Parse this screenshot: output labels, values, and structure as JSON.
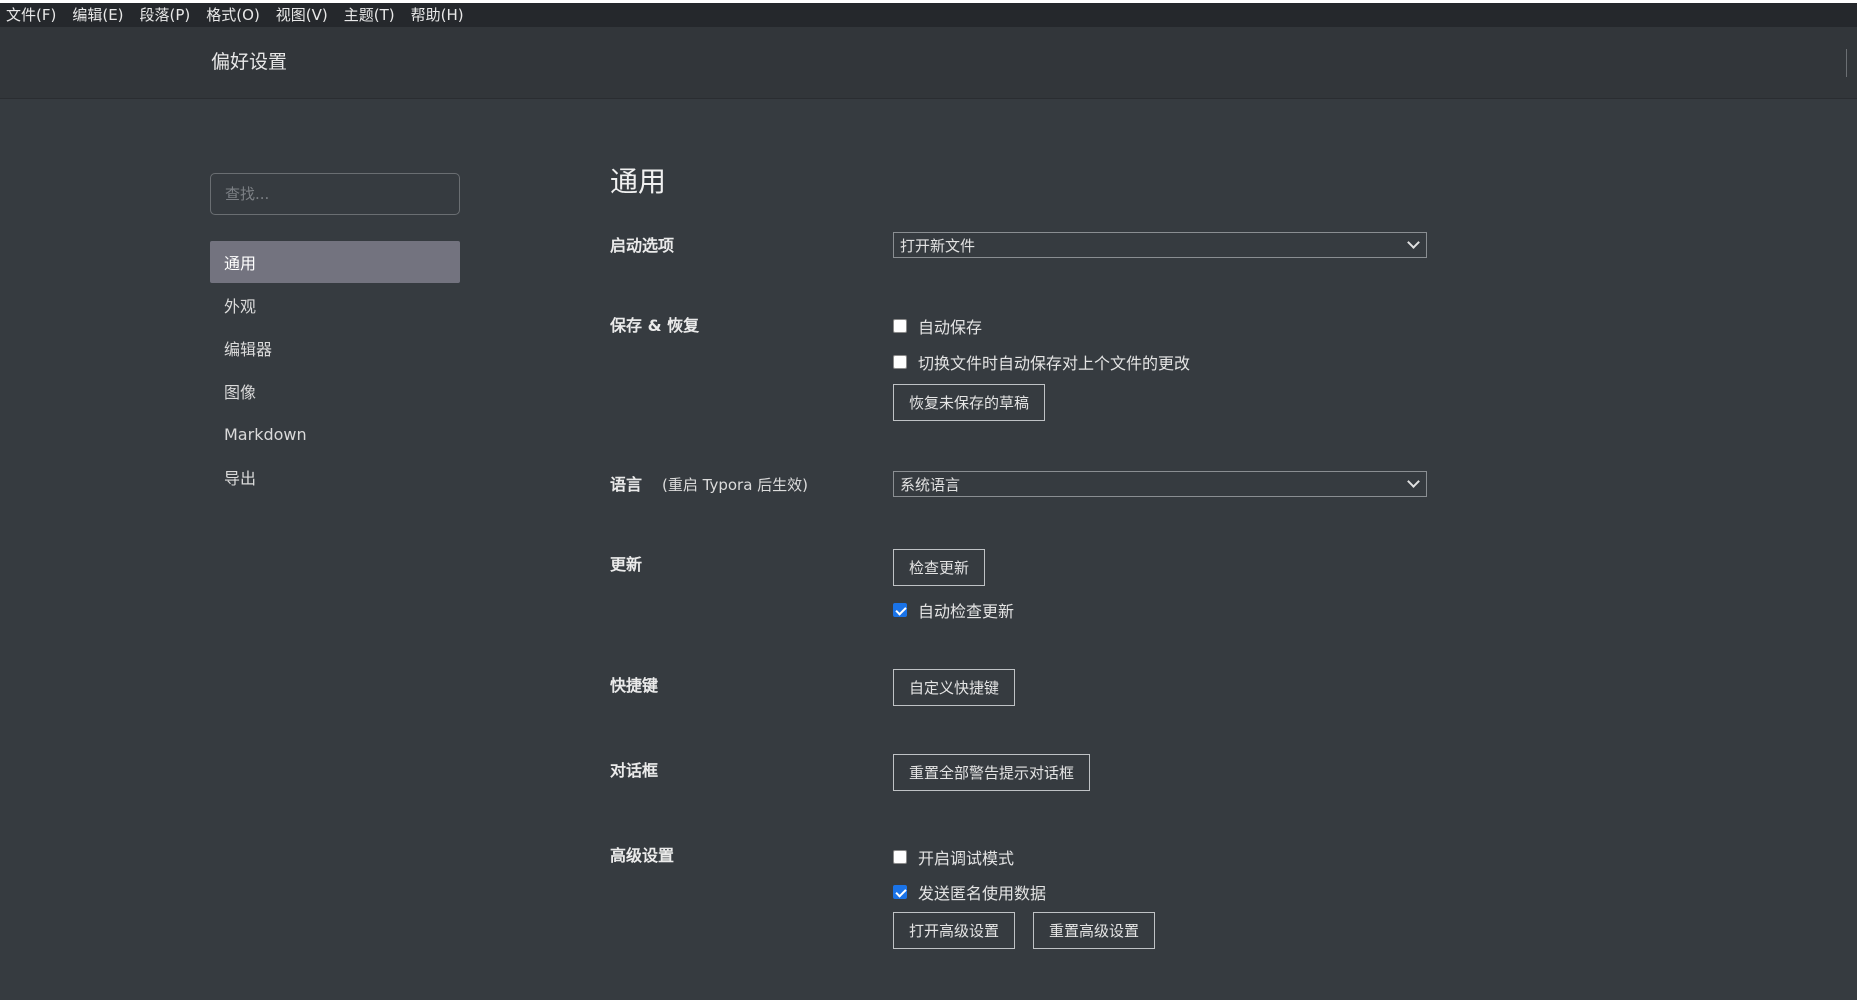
{
  "menubar": {
    "items": [
      "文件(F)",
      "编辑(E)",
      "段落(P)",
      "格式(O)",
      "视图(V)",
      "主题(T)",
      "帮助(H)"
    ]
  },
  "window": {
    "title": "偏好设置"
  },
  "sidebar": {
    "search_placeholder": "查找...",
    "items": [
      {
        "label": "通用",
        "active": true
      },
      {
        "label": "外观",
        "active": false
      },
      {
        "label": "编辑器",
        "active": false
      },
      {
        "label": "图像",
        "active": false
      },
      {
        "label": "Markdown",
        "active": false
      },
      {
        "label": "导出",
        "active": false
      }
    ]
  },
  "general": {
    "heading": "通用",
    "startup": {
      "label": "启动选项",
      "value": "打开新文件"
    },
    "save": {
      "label": "保存 & 恢复",
      "autosave": {
        "label": "自动保存",
        "checked": false
      },
      "autosave_switch": {
        "label": "切换文件时自动保存对上个文件的更改",
        "checked": false
      },
      "restore_button": "恢复未保存的草稿"
    },
    "language": {
      "label": "语言",
      "note": "(重启 Typora 后生效)",
      "value": "系统语言"
    },
    "update": {
      "label": "更新",
      "check_button": "检查更新",
      "auto_check": {
        "label": "自动检查更新",
        "checked": true
      }
    },
    "shortcuts": {
      "label": "快捷键",
      "button": "自定义快捷键"
    },
    "dialogs": {
      "label": "对话框",
      "button": "重置全部警告提示对话框"
    },
    "advanced": {
      "label": "高级设置",
      "debug": {
        "label": "开启调试模式",
        "checked": false
      },
      "telemetry": {
        "label": "发送匿名使用数据",
        "checked": true
      },
      "open_button": "打开高级设置",
      "reset_button": "重置高级设置"
    }
  },
  "colors": {
    "background": "#363b40",
    "menubar": "#25282c",
    "active_nav": "#73737f",
    "checkbox_checked": "#1a73e8"
  }
}
